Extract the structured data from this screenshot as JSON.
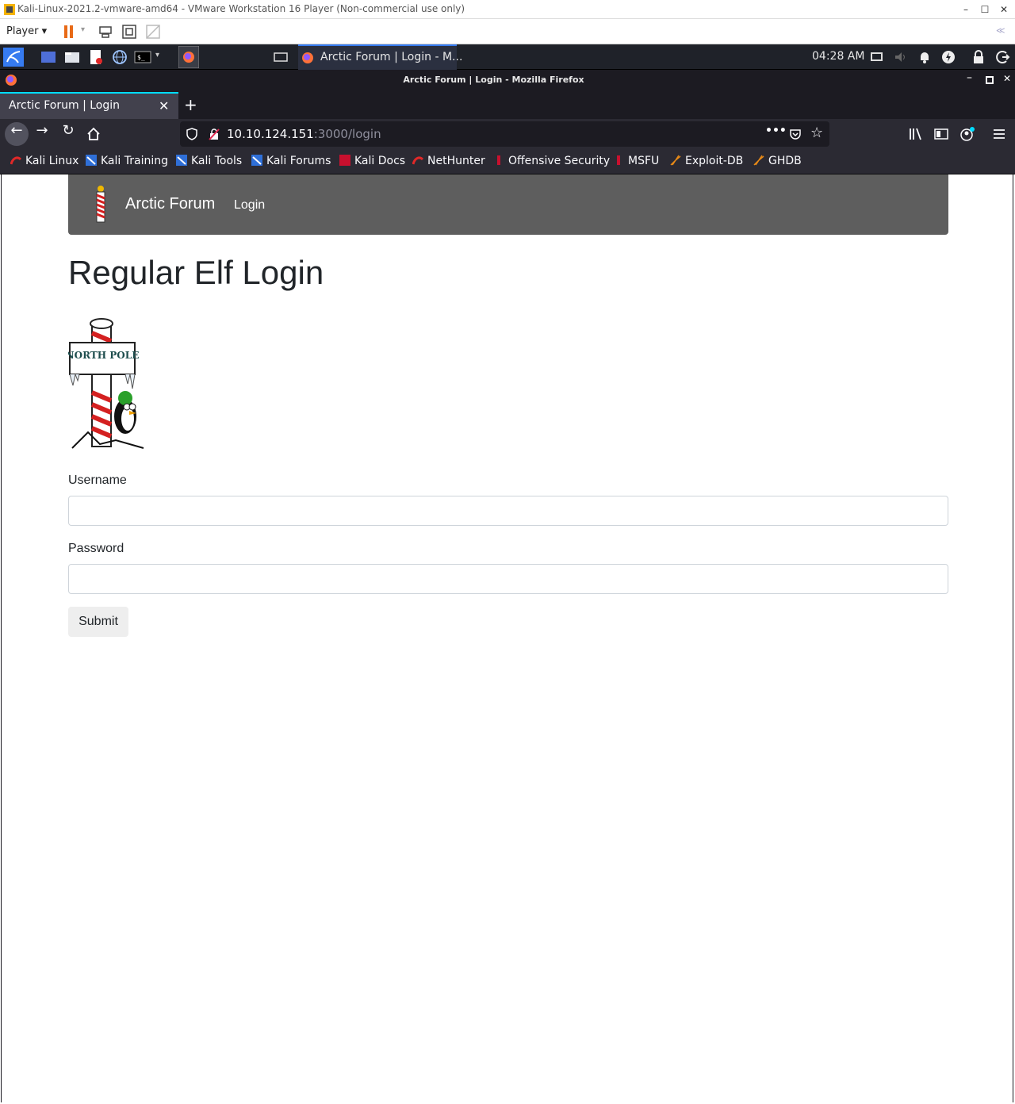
{
  "vmware": {
    "window_title": "Kali-Linux-2021.2-vmware-amd64 - VMware Workstation 16 Player (Non-commercial use only)",
    "player_menu": "Player",
    "minimize": "–",
    "maximize": "☐",
    "close": "✕",
    "collapse": "≪"
  },
  "kali_panel": {
    "task_label": "Arctic Forum | Login - M...",
    "clock": "04:28 AM"
  },
  "firefox": {
    "window_title": "Arctic Forum | Login - Mozilla Firefox",
    "tab_title": "Arctic Forum | Login",
    "tab_close": "✕",
    "new_tab": "+",
    "url_host": "10.10.124.151",
    "url_path": ":3000/login",
    "bookmarks": [
      "Kali Linux",
      "Kali Training",
      "Kali Tools",
      "Kali Forums",
      "Kali Docs",
      "NetHunter",
      "Offensive Security",
      "MSFU",
      "Exploit-DB",
      "GHDB"
    ]
  },
  "site": {
    "brand": "Arctic Forum",
    "nav_login": "Login",
    "page_title": "Regular Elf Login",
    "username_label": "Username",
    "username_value": "",
    "password_label": "Password",
    "password_value": "",
    "submit_label": "Submit",
    "sign_text": "NORTH POLE"
  }
}
